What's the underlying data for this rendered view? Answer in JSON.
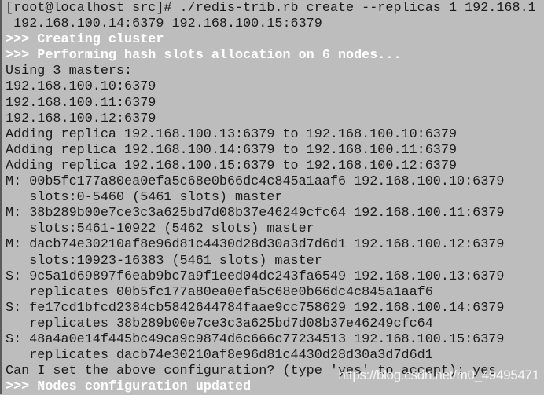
{
  "terminal": {
    "lines": [
      {
        "text": "[root@localhost src]# ./redis-trib.rb create --replicas 1 192.168.1",
        "highlight": false
      },
      {
        "text": " 192.168.100.14:6379 192.168.100.15:6379",
        "highlight": false
      },
      {
        "text": ">>> Creating cluster",
        "highlight": true
      },
      {
        "text": ">>> Performing hash slots allocation on 6 nodes...",
        "highlight": true
      },
      {
        "text": "Using 3 masters:",
        "highlight": false
      },
      {
        "text": "192.168.100.10:6379",
        "highlight": false
      },
      {
        "text": "192.168.100.11:6379",
        "highlight": false
      },
      {
        "text": "192.168.100.12:6379",
        "highlight": false
      },
      {
        "text": "Adding replica 192.168.100.13:6379 to 192.168.100.10:6379",
        "highlight": false
      },
      {
        "text": "Adding replica 192.168.100.14:6379 to 192.168.100.11:6379",
        "highlight": false
      },
      {
        "text": "Adding replica 192.168.100.15:6379 to 192.168.100.12:6379",
        "highlight": false
      },
      {
        "text": "M: 00b5fc177a80ea0efa5c68e0b66dc4c845a1aaf6 192.168.100.10:6379",
        "highlight": false
      },
      {
        "text": "   slots:0-5460 (5461 slots) master",
        "highlight": false
      },
      {
        "text": "M: 38b289b00e7ce3c3a625bd7d08b37e46249cfc64 192.168.100.11:6379",
        "highlight": false
      },
      {
        "text": "   slots:5461-10922 (5462 slots) master",
        "highlight": false
      },
      {
        "text": "M: dacb74e30210af8e96d81c4430d28d30a3d7d6d1 192.168.100.12:6379",
        "highlight": false
      },
      {
        "text": "   slots:10923-16383 (5461 slots) master",
        "highlight": false
      },
      {
        "text": "S: 9c5a1d69897f6eab9bc7a9f1eed04dc243fa6549 192.168.100.13:6379",
        "highlight": false
      },
      {
        "text": "   replicates 00b5fc177a80ea0efa5c68e0b66dc4c845a1aaf6",
        "highlight": false
      },
      {
        "text": "S: fe17cd1bfcd2384cb5842644784faae9cc758629 192.168.100.14:6379",
        "highlight": false
      },
      {
        "text": "   replicates 38b289b00e7ce3c3a625bd7d08b37e46249cfc64",
        "highlight": false
      },
      {
        "text": "S: 48a4a0e14f445bc49ca9c9874d6c666c77234513 192.168.100.15:6379",
        "highlight": false
      },
      {
        "text": "   replicates dacb74e30210af8e96d81c4430d28d30a3d7d6d1",
        "highlight": false
      },
      {
        "text": "Can I set the above configuration? (type 'yes' to accept): yes",
        "highlight": false
      },
      {
        "text": ">>> Nodes configuration updated",
        "highlight": true
      }
    ]
  },
  "watermark": "https://blog.csdn.net/m0_49495471",
  "colors": {
    "background": "#bdbdbd",
    "text": "#1a1a1a",
    "highlight_text": "#ffffff"
  }
}
